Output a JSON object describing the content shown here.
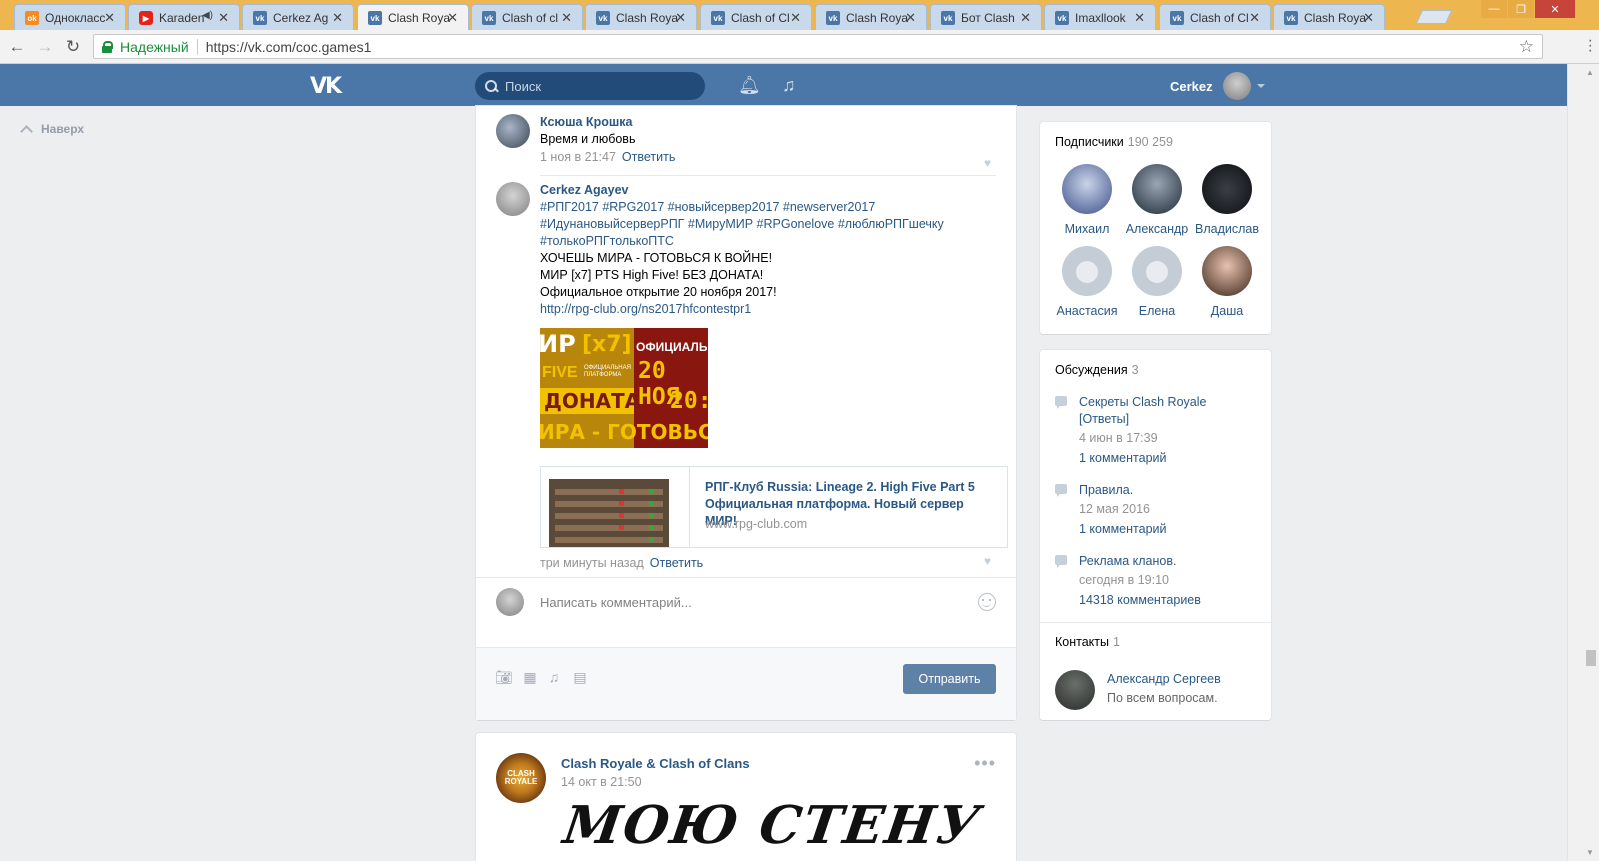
{
  "browser": {
    "tabs": [
      {
        "label": "Однокласс",
        "favicon": "ok"
      },
      {
        "label": "Karaden",
        "favicon": "yt",
        "speaker": true
      },
      {
        "label": "Cerkez Ag",
        "favicon": "vk"
      },
      {
        "label": "Clash Roya",
        "favicon": "vk",
        "active": true
      },
      {
        "label": "Clash of cl",
        "favicon": "vk"
      },
      {
        "label": "Clash Roya",
        "favicon": "vk"
      },
      {
        "label": "Clash of Cl",
        "favicon": "vk"
      },
      {
        "label": "Clash Roya",
        "favicon": "vk"
      },
      {
        "label": "Бот Clash",
        "favicon": "vk"
      },
      {
        "label": "Imaxllook",
        "favicon": "vk"
      },
      {
        "label": "Clash of Cl",
        "favicon": "vk"
      },
      {
        "label": "Clash Roya",
        "favicon": "vk"
      }
    ],
    "secure_label": "Надежный",
    "url": "https://vk.com/coc.games1"
  },
  "header": {
    "logo": "VK",
    "search_placeholder": "Поиск",
    "user_name": "Cerkez"
  },
  "left": {
    "up_label": "Наверх"
  },
  "feed": {
    "comment1": {
      "author": "Ксюша Крошка",
      "text": "Время и любовь",
      "date": "1 ноя в 21:47",
      "reply": "Ответить"
    },
    "comment2": {
      "author": "Cerkez Agayev",
      "hashtags_line1": "#РПГ2017 #RPG2017 #новыйсервер2017 #newserver2017",
      "hashtags_line2": "#ИдунановыйсерверРПГ #МируМИР #RPGonelove #люблюРПГшечку",
      "hashtags_line3": "#толькоРПГтолькоПТС",
      "line1": "ХОЧЕШЬ МИРА - ГОТОВЬСЯ К ВОЙНЕ!",
      "line2": "МИР [x7] PTS High Five! БЕЗ ДОНАТА!",
      "line3": "Официальное открытие 20 ноября 2017!",
      "link": "http://rpg-club.org/ns2017hfcontestpr1",
      "image_text": {
        "a": "ИР",
        "b": "[x7]",
        "c": "ОФИЦИАЛЬ",
        "d": "FIVE",
        "e": "ОФИЦИАЛЬНАЯ ПЛАТФОРМА",
        "f": "20 НОЯ",
        "g": "ДОНАТА",
        "h": "20:",
        "i": "ИРА - ГОТОВЬС"
      },
      "snippet_title": "РПГ-Клуб Russia: Lineage 2. High Five Part 5 Официальная платформа. Новый сервер МИР!",
      "snippet_domain": "www.rpg-club.com",
      "date": "три минуты назад",
      "reply": "Ответить"
    },
    "reply_placeholder": "Написать комментарий...",
    "send_label": "Отправить",
    "post2": {
      "author": "Clash Royale & Clash of Clans",
      "date": "14 окт в 21:50",
      "avatar_text": "CLASH ROYALE",
      "big_text": "МОЮ СТЕНУ"
    }
  },
  "sidebar": {
    "subscribers": {
      "title": "Подписчики",
      "count": "190 259",
      "members": [
        "Михаил",
        "Александр",
        "Владислав",
        "Анастасия",
        "Елена",
        "Даша"
      ]
    },
    "discussions": {
      "title": "Обсуждения",
      "count": "3",
      "items": [
        {
          "title": "Секреты Clash Royale [Ответы]",
          "date": "4 июн в 17:39",
          "comments": "1 комментарий"
        },
        {
          "title": "Правила.",
          "date": "12 мая 2016",
          "comments": "1 комментарий"
        },
        {
          "title": "Реклама кланов.",
          "date": "сегодня в 19:10",
          "comments": "14318 комментариев"
        }
      ]
    },
    "contacts": {
      "title": "Контакты",
      "count": "1",
      "name": "Александр Сергеев",
      "role": "По всем вопросам."
    }
  },
  "colors": {
    "vk_blue": "#4a76a8",
    "link": "#2a5885",
    "page_bg": "#edeef0",
    "tabbar": "#eeb64f"
  }
}
